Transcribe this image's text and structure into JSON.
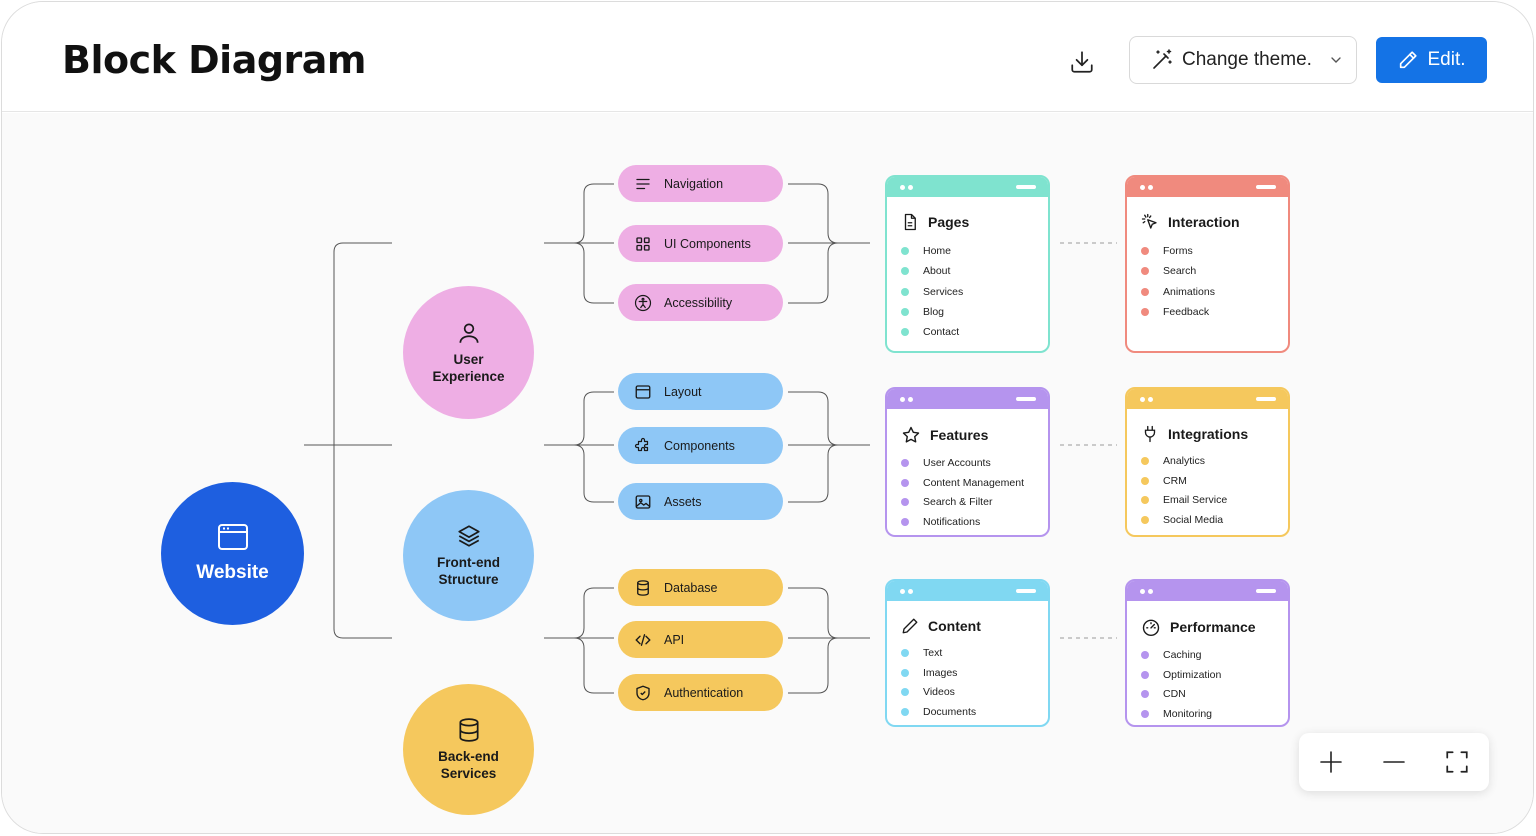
{
  "header": {
    "title": "Block Diagram",
    "theme_label": "Change theme.",
    "edit_label": "Edit."
  },
  "root": {
    "label": "Website",
    "icon": "browser-window-icon",
    "color": "#1e5fe0"
  },
  "branches": [
    {
      "label": "User Experience",
      "icon": "user-icon",
      "color": "#eeaee4",
      "items": [
        {
          "label": "Navigation",
          "icon": "menu-icon"
        },
        {
          "label": "UI Components",
          "icon": "grid-icon"
        },
        {
          "label": "Accessibility",
          "icon": "accessibility-icon"
        }
      ]
    },
    {
      "label": "Front-end Structure",
      "icon": "layers-icon",
      "color": "#8ec7f6",
      "items": [
        {
          "label": "Layout",
          "icon": "layout-icon"
        },
        {
          "label": "Components",
          "icon": "puzzle-icon"
        },
        {
          "label": "Assets",
          "icon": "image-icon"
        }
      ]
    },
    {
      "label": "Back-end Services",
      "icon": "database-icon",
      "color": "#f5c85d",
      "items": [
        {
          "label": "Database",
          "icon": "database-icon"
        },
        {
          "label": "API",
          "icon": "code-icon"
        },
        {
          "label": "Authentication",
          "icon": "shield-check-icon"
        }
      ]
    }
  ],
  "cards": [
    {
      "title": "Pages",
      "icon": "document-icon",
      "color": "#7fe3cf",
      "items": [
        "Home",
        "About",
        "Services",
        "Blog",
        "Contact"
      ]
    },
    {
      "title": "Interaction",
      "icon": "cursor-click-icon",
      "color": "#f08a7e",
      "items": [
        "Forms",
        "Search",
        "Animations",
        "Feedback"
      ]
    },
    {
      "title": "Features",
      "icon": "star-icon",
      "color": "#b594ee",
      "items": [
        "User Accounts",
        "Content Management",
        "Search & Filter",
        "Notifications"
      ]
    },
    {
      "title": "Integrations",
      "icon": "plug-icon",
      "color": "#f5c85d",
      "items": [
        "Analytics",
        "CRM",
        "Email Service",
        "Social Media"
      ]
    },
    {
      "title": "Content",
      "icon": "pen-icon",
      "color": "#80d8f2",
      "items": [
        "Text",
        "Images",
        "Videos",
        "Documents"
      ]
    },
    {
      "title": "Performance",
      "icon": "gauge-icon",
      "color": "#b594ee",
      "items": [
        "Caching",
        "Optimization",
        "CDN",
        "Monitoring"
      ]
    }
  ],
  "colors": {
    "accent": "#1473e6"
  }
}
